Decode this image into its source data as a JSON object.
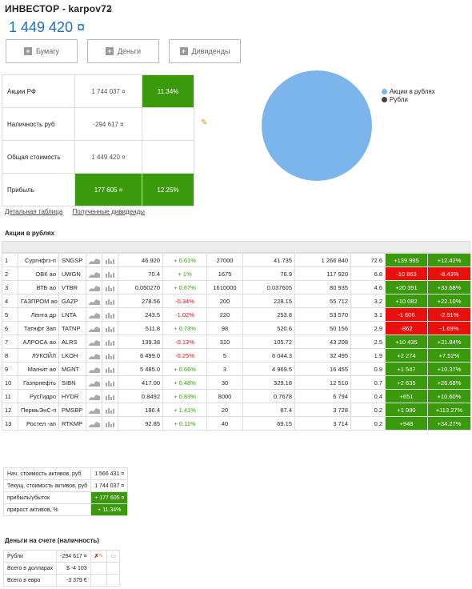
{
  "header": {
    "title": "ИНВЕСТОР - karpov72",
    "total": "1 449 420 ¤"
  },
  "buttons": [
    {
      "label": "Бумагу"
    },
    {
      "label": "Деньги"
    },
    {
      "label": "Дивиденды"
    }
  ],
  "summary": {
    "rows": [
      {
        "label": "Акции РФ",
        "value": "1 744 037 ¤",
        "extra": "11.34%"
      },
      {
        "label": "Наличность руб",
        "value": "-294 617 ¤",
        "extra": ""
      },
      {
        "label": "Общая стоимость",
        "value": "1 449 420 ¤",
        "extra": ""
      },
      {
        "label": "Прибыль",
        "value": "177 605 ¤",
        "extra": "12.25%"
      }
    ]
  },
  "pie": {
    "legend": [
      {
        "label": "Акции в рублях",
        "color": "#7cb5ec"
      },
      {
        "label": "Рубли",
        "color": "#434348"
      }
    ]
  },
  "links": {
    "detail": "Детальная таблица",
    "dividends": "Полученные дивиденды"
  },
  "stocks": {
    "title": "Акции в рублях",
    "rows": [
      {
        "n": "1",
        "name": "Сургнфгз-п",
        "ticker": "SNGSP",
        "price": "46.920",
        "chg": "+ 0.61%",
        "qty": "27000",
        "avg": "41.735",
        "value": "1 266 840",
        "share": "72.6",
        "pl": "+139 995",
        "plpct": "+12.42%",
        "neg": false,
        "chgneg": false
      },
      {
        "n": "2",
        "name": "ОВК ао",
        "ticker": "UWGN",
        "price": "70.4",
        "chg": "+ 1%",
        "qty": "1675",
        "avg": "76.9",
        "value": "117 920",
        "share": "6.8",
        "pl": "-10 863",
        "plpct": "-8.43%",
        "neg": true,
        "chgneg": false
      },
      {
        "n": "3",
        "name": "ВТБ ао",
        "ticker": "VTBR",
        "price": "0.050270",
        "chg": "+ 0.67%",
        "qty": "1610000",
        "avg": "0.037605",
        "value": "80 935",
        "share": "4.6",
        "pl": "+20 391",
        "plpct": "+33.68%",
        "neg": false,
        "chgneg": false
      },
      {
        "n": "4",
        "name": "ГАЗПРОМ ао",
        "ticker": "GAZP",
        "price": "278.56",
        "chg": "-0.34%",
        "qty": "200",
        "avg": "228.15",
        "value": "55 712",
        "share": "3.2",
        "pl": "+10 082",
        "plpct": "+22.10%",
        "neg": false,
        "chgneg": true
      },
      {
        "n": "5",
        "name": "Лента др",
        "ticker": "LNTA",
        "price": "243.5",
        "chg": "-1.02%",
        "qty": "220",
        "avg": "253.8",
        "value": "53 570",
        "share": "3.1",
        "pl": "-1 606",
        "plpct": "-2.91%",
        "neg": true,
        "chgneg": true
      },
      {
        "n": "6",
        "name": "Татнфт Зап",
        "ticker": "TATNP",
        "price": "511.8",
        "chg": "+ 0.73%",
        "qty": "98",
        "avg": "520.6",
        "value": "50 156",
        "share": "2.9",
        "pl": "-862",
        "plpct": "-1.69%",
        "neg": true,
        "chgneg": false
      },
      {
        "n": "7",
        "name": "АЛРОСА ао",
        "ticker": "ALRS",
        "price": "139.38",
        "chg": "-0.13%",
        "qty": "310",
        "avg": "105.72",
        "value": "43 208",
        "share": "2.5",
        "pl": "+10 435",
        "plpct": "+31.84%",
        "neg": false,
        "chgneg": true
      },
      {
        "n": "8",
        "name": "ЛУКОЙЛ",
        "ticker": "LKOH",
        "price": "6 499.0",
        "chg": "-0.25%",
        "qty": "5",
        "avg": "6 044.3",
        "value": "32 495",
        "share": "1.9",
        "pl": "+2 274",
        "plpct": "+7.52%",
        "neg": false,
        "chgneg": true
      },
      {
        "n": "9",
        "name": "Магнит ао",
        "ticker": "MGNT",
        "price": "5 485.0",
        "chg": "+ 0.66%",
        "qty": "3",
        "avg": "4 969.5",
        "value": "16 455",
        "share": "0.9",
        "pl": "+1 547",
        "plpct": "+10.37%",
        "neg": false,
        "chgneg": false
      },
      {
        "n": "10",
        "name": "Газпрнефть",
        "ticker": "SIBN",
        "price": "417.00",
        "chg": "+ 0.48%",
        "qty": "30",
        "avg": "329.18",
        "value": "12 510",
        "share": "0.7",
        "pl": "+2 635",
        "plpct": "+26.68%",
        "neg": false,
        "chgneg": false
      },
      {
        "n": "11",
        "name": "РусГидро",
        "ticker": "HYDR",
        "price": "0.8492",
        "chg": "+ 0.83%",
        "qty": "8000",
        "avg": "0.7678",
        "value": "6 794",
        "share": "0.4",
        "pl": "+651",
        "plpct": "+10.60%",
        "neg": false,
        "chgneg": false
      },
      {
        "n": "12",
        "name": "ПермьЭнС-п",
        "ticker": "PMSBP",
        "price": "186.4",
        "chg": "+ 1.41%",
        "qty": "20",
        "avg": "87.4",
        "value": "3 728",
        "share": "0.2",
        "pl": "+1 980",
        "plpct": "+113.27%",
        "neg": false,
        "chgneg": false
      },
      {
        "n": "13",
        "name": "Ростел -ап",
        "ticker": "RTKMP",
        "price": "92.85",
        "chg": "+ 0.11%",
        "qty": "40",
        "avg": "69.15",
        "value": "3 714",
        "share": "0.2",
        "pl": "+948",
        "plpct": "+34.27%",
        "neg": false,
        "chgneg": false
      }
    ]
  },
  "assets": {
    "rows": [
      {
        "label": "Нач. стоимость активов, руб",
        "value": "1 566 431 ¤",
        "green": false
      },
      {
        "label": "Текущ. стоимость активов, руб",
        "value": "1 744 037 ¤",
        "green": false
      },
      {
        "label": "прибыль/убыток",
        "value": "+ 177 605 ¤",
        "green": true
      },
      {
        "label": "прирост активов, %",
        "value": "+ 11.34%",
        "green": true
      }
    ]
  },
  "cash": {
    "title": "Деньги на счете (наличность)",
    "rows": [
      {
        "label": "Рубли",
        "value": "-294 617 ¤"
      },
      {
        "label": "Всего в долларах",
        "value": "$ -4 103"
      },
      {
        "label": "Всего в евро",
        "value": "-3 379 €"
      }
    ]
  }
}
